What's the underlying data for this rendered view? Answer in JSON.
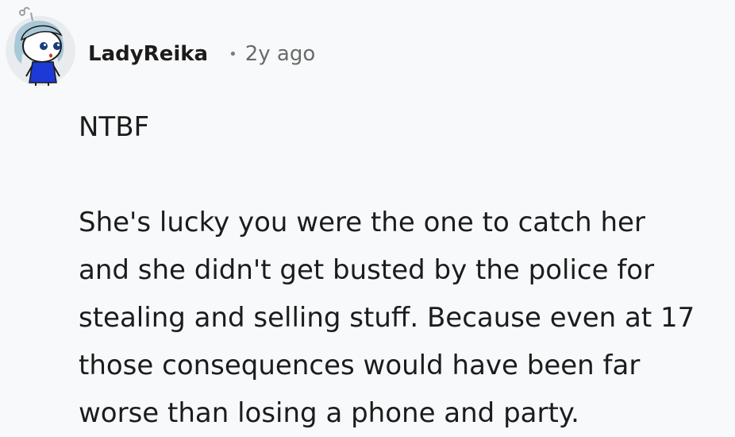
{
  "comment": {
    "author": "LadyReika",
    "separator": "•",
    "timestamp": "2y ago",
    "paragraphs": [
      "NTBF",
      [
        "She's lucky you were the one to catch her",
        "and she didn't get busted by the police for",
        "stealing and selling stuff. Because even at 17",
        "those consequences would have been far",
        "worse than losing a phone and party."
      ]
    ]
  },
  "avatar": {
    "icon": "snoo-avatar-icon",
    "colors": {
      "background": "#e9ecee",
      "hair": "#a9c8d8",
      "shirt": "#1d3ad6",
      "eyes": "#1a3c7a"
    }
  }
}
